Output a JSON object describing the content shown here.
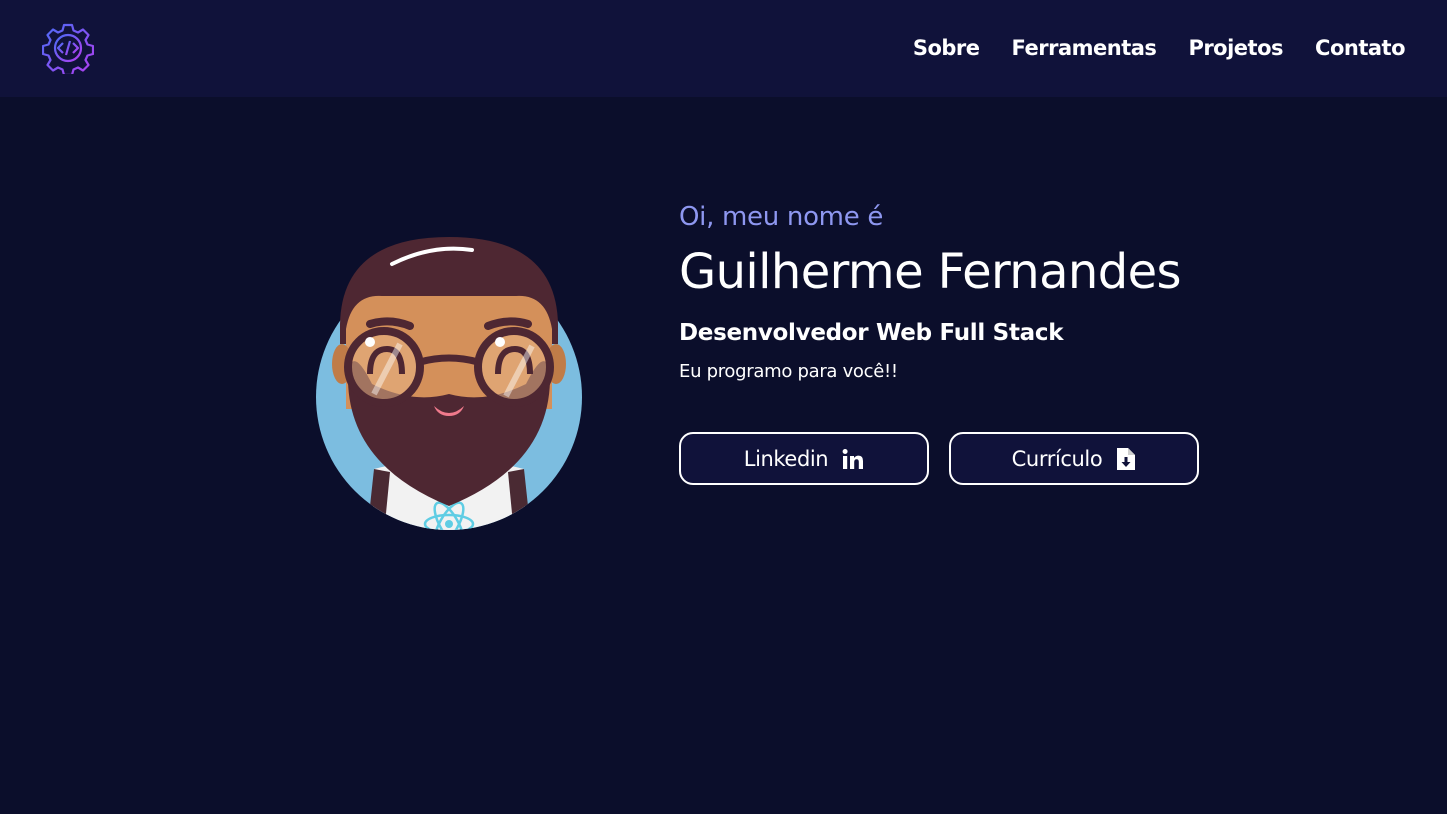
{
  "nav": {
    "logo_icon": "gear-code-icon",
    "links": [
      {
        "label": "Sobre"
      },
      {
        "label": "Ferramentas"
      },
      {
        "label": "Projetos"
      },
      {
        "label": "Contato"
      }
    ]
  },
  "hero": {
    "greeting": "Oi, meu nome é",
    "name": "Guilherme Fernandes",
    "role": "Desenvolvedor Web Full Stack",
    "tagline": "Eu programo para você!!",
    "buttons": [
      {
        "label": "Linkedin",
        "icon": "linkedin-icon"
      },
      {
        "label": "Currículo",
        "icon": "file-download-icon"
      }
    ]
  },
  "colors": {
    "background": "#0b0e2b",
    "navbar": "#10123a",
    "accent": "#8e97f0",
    "avatar_bg": "#7cbde0"
  }
}
